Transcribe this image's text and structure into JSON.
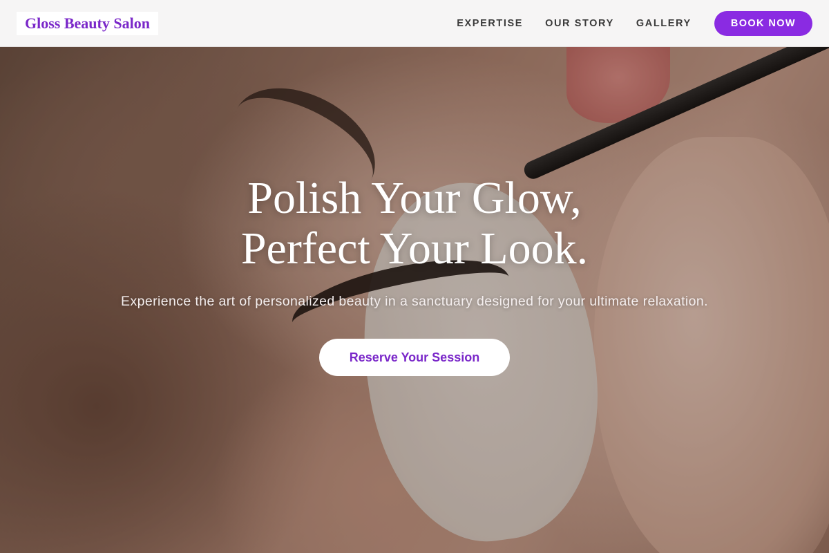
{
  "brand": {
    "logo_text": "Gloss Beauty Salon",
    "accent_color": "#8a2be2",
    "logo_color": "#7a27c9"
  },
  "nav": {
    "links": [
      {
        "label": "EXPERTISE"
      },
      {
        "label": "OUR STORY"
      },
      {
        "label": "GALLERY"
      }
    ],
    "book_label": "BOOK NOW"
  },
  "hero": {
    "title_line1": "Polish Your Glow,",
    "title_line2": "Perfect Your Look.",
    "subtitle": "Experience the art of personalized beauty in a sanctuary designed for your ultimate relaxation.",
    "cta_label": "Reserve Your Session",
    "background_image": "close-up of eyelash extension application with tweezers"
  }
}
